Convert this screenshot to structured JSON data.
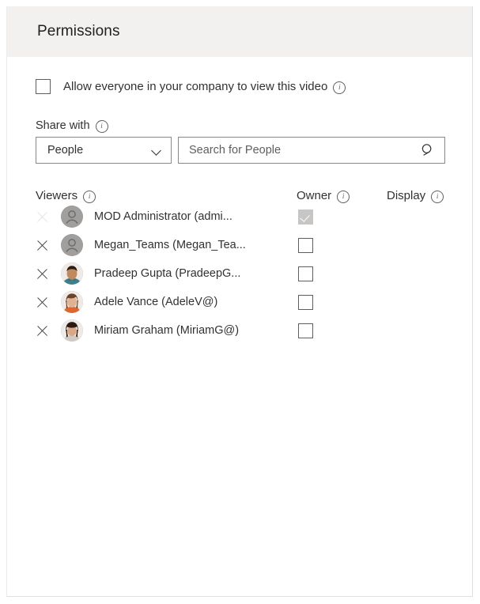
{
  "panel": {
    "title": "Permissions"
  },
  "allow_everyone": {
    "label": "Allow everyone in your company to view this video",
    "checked": false,
    "info_icon": "info-icon"
  },
  "share_with": {
    "label": "Share with",
    "info_icon": "info-icon",
    "dropdown": {
      "selected": "People",
      "chevron_icon": "chevron-down-icon"
    },
    "search": {
      "value": "",
      "placeholder": "Search for People",
      "icon": "search-icon"
    }
  },
  "table": {
    "columns": [
      {
        "label": "Viewers",
        "info_icon": "info-icon"
      },
      {
        "label": "Owner",
        "info_icon": "info-icon"
      },
      {
        "label": "Display",
        "info_icon": "info-icon"
      }
    ],
    "rows": [
      {
        "name": "MOD Administrator (admi...",
        "avatar_type": "placeholder",
        "avatar_bg": "#a19f9d",
        "owner_checked": true,
        "owner_disabled": true,
        "remove_disabled": true,
        "display": ""
      },
      {
        "name": "Megan_Teams (Megan_Tea...",
        "avatar_type": "placeholder",
        "avatar_bg": "#a19f9d",
        "owner_checked": false,
        "owner_disabled": false,
        "remove_disabled": false,
        "display": ""
      },
      {
        "name": "Pradeep Gupta (PradeepG...",
        "avatar_type": "photo",
        "avatar_hair": "#2b1d16",
        "avatar_skin": "#c08a5e",
        "avatar_cloth": "#3d7f8c",
        "owner_checked": false,
        "owner_disabled": false,
        "remove_disabled": false,
        "display": ""
      },
      {
        "name": "Adele Vance (AdeleV@)",
        "avatar_type": "photo",
        "avatar_hair": "#6b4329",
        "avatar_skin": "#e0b394",
        "avatar_cloth": "#e0662f",
        "owner_checked": false,
        "owner_disabled": false,
        "remove_disabled": false,
        "display": ""
      },
      {
        "name": "Miriam Graham (MiriamG@)",
        "avatar_type": "photo",
        "avatar_hair": "#2a1a14",
        "avatar_skin": "#dba887",
        "avatar_cloth": "#cfcac4",
        "owner_checked": false,
        "owner_disabled": false,
        "remove_disabled": false,
        "display": ""
      }
    ]
  },
  "colors": {
    "header_bg": "#f2f1f0",
    "panel_border": "#e1dfdd",
    "text": "#323130",
    "muted_text": "#605e5c",
    "control_border": "#8a8886",
    "disabled_fill": "#c8c6c4"
  }
}
